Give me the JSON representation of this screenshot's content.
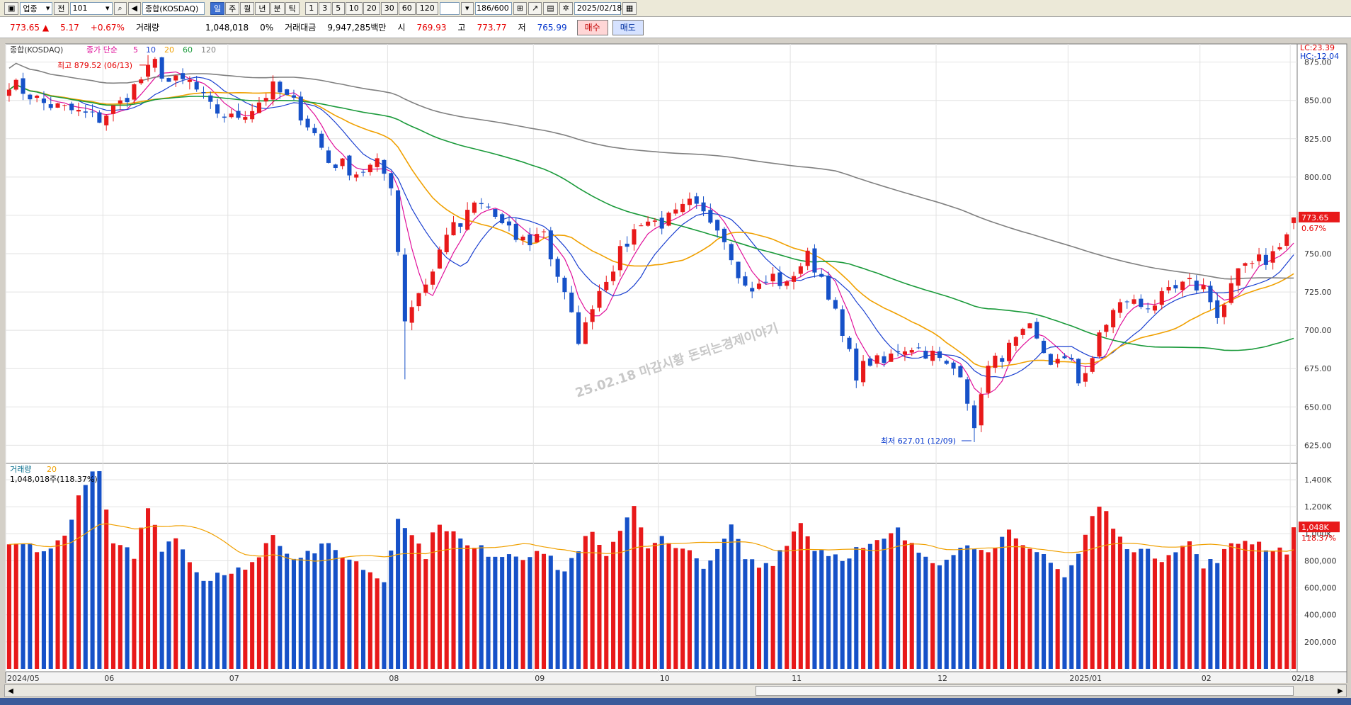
{
  "toolbar": {
    "category": "업종",
    "prev_label": "전",
    "code": "101",
    "name": "종합(KOSDAQ)",
    "periods": [
      "일",
      "주",
      "월",
      "년",
      "분",
      "틱"
    ],
    "active_period": "일",
    "intervals": [
      "1",
      "3",
      "5",
      "10",
      "20",
      "30",
      "60",
      "120"
    ],
    "count": "186/600",
    "date": "2025/02/18"
  },
  "quote": {
    "price": "773.65",
    "direction": "▲",
    "change": "5.17",
    "change_pct": "+0.67%",
    "volume_label": "거래량",
    "volume": "1,048,018",
    "vol_pct": "0%",
    "amount_label": "거래대금",
    "amount": "9,947,285백만",
    "open_label": "시",
    "open": "769.93",
    "high_label": "고",
    "high": "773.77",
    "low_label": "저",
    "low": "765.99",
    "buy_label": "매수",
    "sell_label": "매도"
  },
  "legend": {
    "title": "종합(KOSDAQ)",
    "ma_label": "종가 단순",
    "ma_periods": [
      "5",
      "10",
      "20",
      "60",
      "120"
    ],
    "ma_colors": [
      "#e0109a",
      "#1a3fd0",
      "#f0a000",
      "#1a9a3a",
      "#808080"
    ]
  },
  "annotations": {
    "high_note": "최고 879.52 (06/13)",
    "low_note": "최저 627.01 (12/09)",
    "watermark": "25.02.18 마감시황 돈되는경제이야기",
    "lc": "LC:23.39",
    "hc": "HC:-12.04",
    "last_price_tag": "773.65",
    "last_pct_tag": "0.67%",
    "vol_tag": "1,048K",
    "vol_pct_tag": "118.37%"
  },
  "volume_panel": {
    "title": "거래량",
    "ma": "20",
    "last_note": "1,048,018주(118.37%)"
  },
  "x_axis_labels": [
    {
      "label": "2024/05",
      "i": 0
    },
    {
      "label": "06",
      "i": 14
    },
    {
      "label": "07",
      "i": 32
    },
    {
      "label": "08",
      "i": 55
    },
    {
      "label": "09",
      "i": 76
    },
    {
      "label": "10",
      "i": 94
    },
    {
      "label": "11",
      "i": 113
    },
    {
      "label": "12",
      "i": 134
    },
    {
      "label": "2025/01",
      "i": 153
    },
    {
      "label": "02",
      "i": 172
    },
    {
      "label": "02/18",
      "i": 185
    }
  ],
  "chart_data": {
    "type": "candlestick",
    "ylim": [
      615,
      885
    ],
    "y_ticks": [
      625,
      650,
      675,
      700,
      725,
      750,
      775,
      800,
      825,
      850,
      875
    ],
    "volume_ylim": [
      0,
      1500000
    ],
    "volume_ticks": [
      200000,
      400000,
      600000,
      800000,
      1000000,
      1200000,
      1400000
    ],
    "volume_tick_labels": [
      "200,000",
      "400,000",
      "600,000",
      "800,000",
      "1,000K",
      "1,200K",
      "1,400K"
    ],
    "up_color": "#e8191a",
    "down_color": "#1651c8",
    "close_points": [
      [
        0,
        862
      ],
      [
        5,
        848
      ],
      [
        10,
        842
      ],
      [
        13,
        838
      ],
      [
        16,
        848
      ],
      [
        19,
        864
      ],
      [
        21,
        874
      ],
      [
        23,
        862
      ],
      [
        26,
        862
      ],
      [
        29,
        845
      ],
      [
        32,
        838
      ],
      [
        35,
        845
      ],
      [
        38,
        858
      ],
      [
        41,
        848
      ],
      [
        44,
        828
      ],
      [
        46,
        810
      ],
      [
        48,
        808
      ],
      [
        50,
        803
      ],
      [
        53,
        808
      ],
      [
        55,
        796
      ],
      [
        57,
        708
      ],
      [
        59,
        725
      ],
      [
        61,
        738
      ],
      [
        63,
        765
      ],
      [
        65,
        768
      ],
      [
        67,
        782
      ],
      [
        69,
        780
      ],
      [
        71,
        768
      ],
      [
        73,
        760
      ],
      [
        75,
        758
      ],
      [
        77,
        766
      ],
      [
        78,
        748
      ],
      [
        79,
        736
      ],
      [
        81,
        708
      ],
      [
        82,
        695
      ],
      [
        83,
        702
      ],
      [
        84,
        718
      ],
      [
        86,
        735
      ],
      [
        88,
        750
      ],
      [
        91,
        772
      ],
      [
        94,
        770
      ],
      [
        96,
        775
      ],
      [
        98,
        782
      ],
      [
        100,
        775
      ],
      [
        102,
        770
      ],
      [
        104,
        750
      ],
      [
        106,
        728
      ],
      [
        108,
        728
      ],
      [
        110,
        735
      ],
      [
        112,
        728
      ],
      [
        113,
        738
      ],
      [
        115,
        748
      ],
      [
        117,
        735
      ],
      [
        118,
        725
      ],
      [
        120,
        695
      ],
      [
        122,
        672
      ],
      [
        124,
        680
      ],
      [
        126,
        678
      ],
      [
        128,
        688
      ],
      [
        130,
        690
      ],
      [
        133,
        684
      ],
      [
        135,
        676
      ],
      [
        137,
        674
      ],
      [
        138,
        656
      ],
      [
        139,
        632
      ],
      [
        140,
        662
      ],
      [
        141,
        675
      ],
      [
        143,
        684
      ],
      [
        145,
        692
      ],
      [
        147,
        700
      ],
      [
        148,
        692
      ],
      [
        150,
        680
      ],
      [
        152,
        678
      ],
      [
        153,
        682
      ],
      [
        154,
        668
      ],
      [
        156,
        678
      ],
      [
        157,
        698
      ],
      [
        159,
        712
      ],
      [
        161,
        720
      ],
      [
        163,
        716
      ],
      [
        165,
        718
      ],
      [
        168,
        726
      ],
      [
        170,
        730
      ],
      [
        172,
        728
      ],
      [
        173,
        722
      ],
      [
        174,
        708
      ],
      [
        175,
        716
      ],
      [
        176,
        728
      ],
      [
        178,
        744
      ],
      [
        180,
        750
      ],
      [
        181,
        746
      ],
      [
        183,
        754
      ],
      [
        184,
        762
      ],
      [
        185,
        773.65
      ]
    ],
    "volume_points": [
      [
        0,
        900000
      ],
      [
        3,
        920000
      ],
      [
        6,
        870000
      ],
      [
        9,
        1100000
      ],
      [
        11,
        1400000
      ],
      [
        13,
        1450000
      ],
      [
        15,
        900000
      ],
      [
        18,
        850000
      ],
      [
        20,
        1200000
      ],
      [
        22,
        900000
      ],
      [
        24,
        1000000
      ],
      [
        26,
        800000
      ],
      [
        28,
        660000
      ],
      [
        30,
        720000
      ],
      [
        32,
        680000
      ],
      [
        34,
        770000
      ],
      [
        36,
        820000
      ],
      [
        38,
        1020000
      ],
      [
        40,
        860000
      ],
      [
        42,
        840000
      ],
      [
        44,
        880000
      ],
      [
        46,
        900000
      ],
      [
        48,
        850000
      ],
      [
        50,
        780000
      ],
      [
        52,
        720000
      ],
      [
        54,
        650000
      ],
      [
        56,
        1150000
      ],
      [
        58,
        980000
      ],
      [
        60,
        850000
      ],
      [
        62,
        1100000
      ],
      [
        64,
        1000000
      ],
      [
        66,
        900000
      ],
      [
        68,
        880000
      ],
      [
        70,
        850000
      ],
      [
        72,
        860000
      ],
      [
        74,
        830000
      ],
      [
        76,
        900000
      ],
      [
        78,
        800000
      ],
      [
        80,
        720000
      ],
      [
        82,
        900000
      ],
      [
        84,
        1000000
      ],
      [
        86,
        800000
      ],
      [
        88,
        1050000
      ],
      [
        90,
        1210000
      ],
      [
        92,
        920000
      ],
      [
        94,
        960000
      ],
      [
        96,
        880000
      ],
      [
        98,
        850000
      ],
      [
        100,
        780000
      ],
      [
        102,
        850000
      ],
      [
        104,
        1050000
      ],
      [
        106,
        820000
      ],
      [
        108,
        760000
      ],
      [
        110,
        800000
      ],
      [
        112,
        950000
      ],
      [
        114,
        1080000
      ],
      [
        116,
        900000
      ],
      [
        118,
        860000
      ],
      [
        120,
        830000
      ],
      [
        122,
        880000
      ],
      [
        124,
        900000
      ],
      [
        126,
        950000
      ],
      [
        128,
        1020000
      ],
      [
        130,
        900000
      ],
      [
        132,
        840000
      ],
      [
        134,
        800000
      ],
      [
        136,
        880000
      ],
      [
        138,
        900000
      ],
      [
        140,
        920000
      ],
      [
        142,
        880000
      ],
      [
        144,
        1000000
      ],
      [
        146,
        880000
      ],
      [
        148,
        860000
      ],
      [
        150,
        820000
      ],
      [
        152,
        680000
      ],
      [
        154,
        850000
      ],
      [
        156,
        1120000
      ],
      [
        157,
        1200000
      ],
      [
        158,
        1150000
      ],
      [
        160,
        950000
      ],
      [
        162,
        900000
      ],
      [
        164,
        850000
      ],
      [
        166,
        830000
      ],
      [
        168,
        900000
      ],
      [
        170,
        930000
      ],
      [
        172,
        750000
      ],
      [
        174,
        820000
      ],
      [
        176,
        900000
      ],
      [
        178,
        960000
      ],
      [
        180,
        930000
      ],
      [
        182,
        890000
      ],
      [
        184,
        880000
      ],
      [
        185,
        1048018
      ]
    ],
    "title": "종합(KOSDAQ)"
  }
}
